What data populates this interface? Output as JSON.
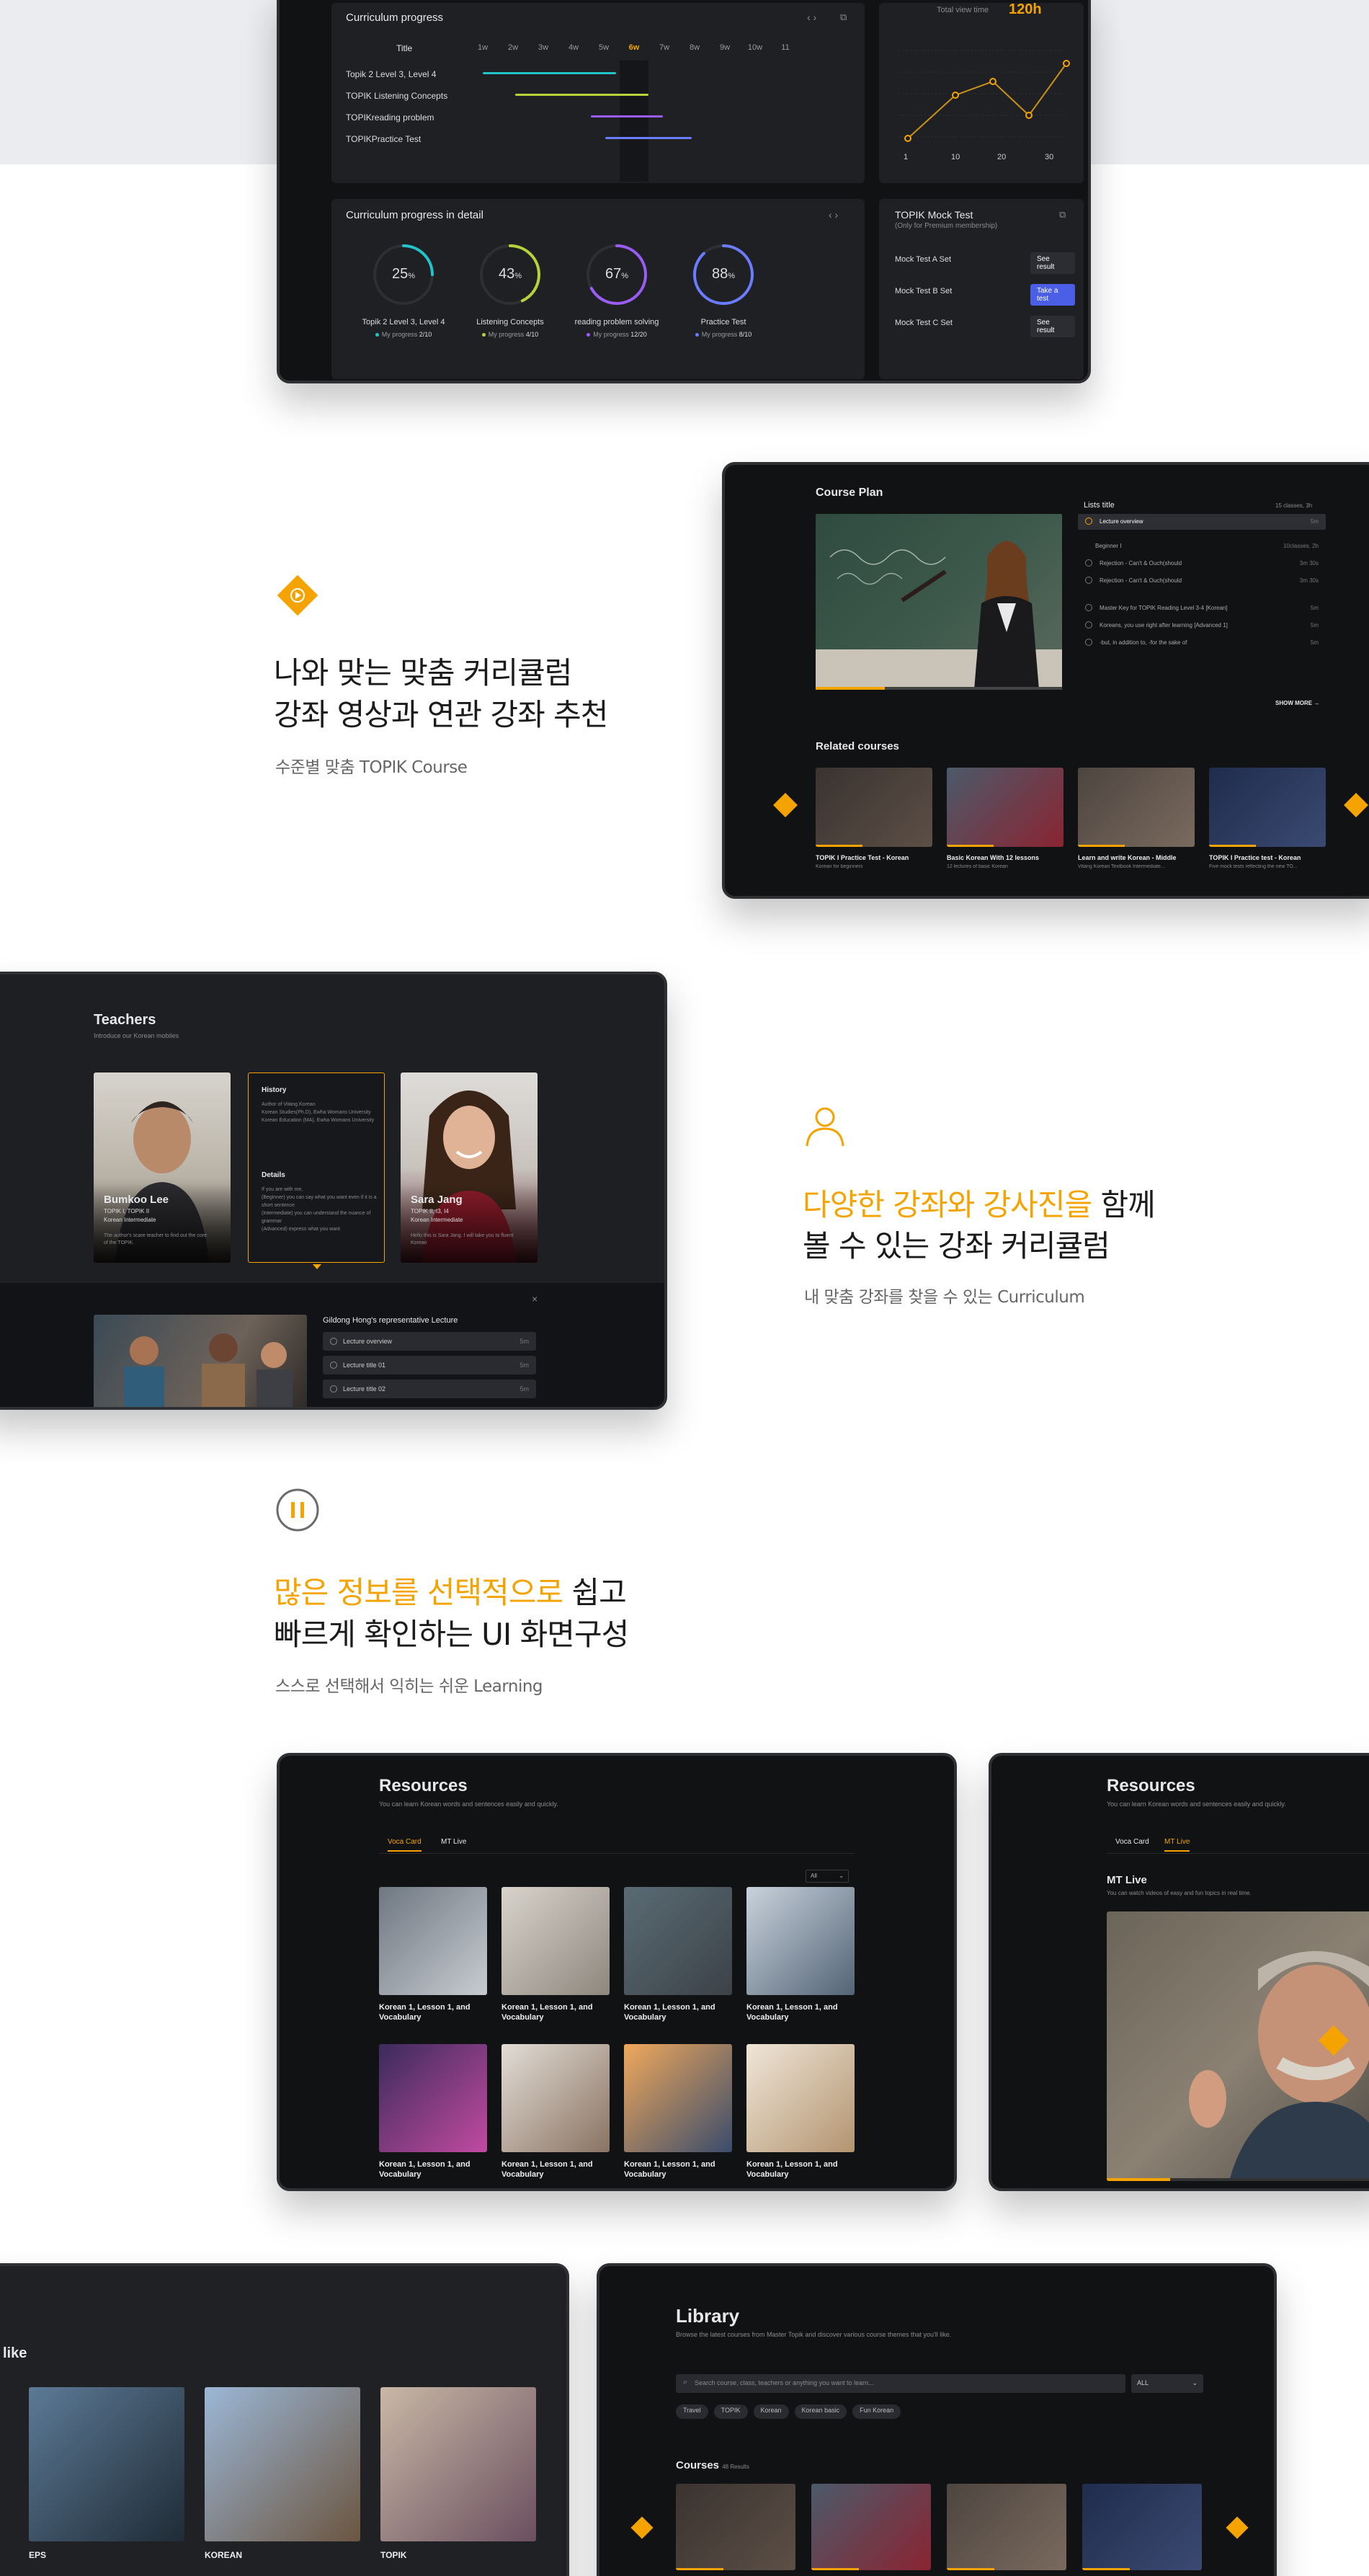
{
  "section1": {
    "curriculum_title": "Curriculum progress",
    "col_title": "Title",
    "weeks": [
      "1w",
      "2w",
      "3w",
      "4w",
      "5w",
      "6w",
      "7w",
      "8w",
      "9w",
      "10w",
      "11"
    ],
    "active_week": "6w",
    "rows": [
      {
        "label": "Topik 2 Level 3, Level 4",
        "color": "#22c3c9"
      },
      {
        "label": "TOPIK Listening Concepts",
        "color": "#b6d43a"
      },
      {
        "label": "TOPIKreading problem",
        "color": "#9b5cf5"
      },
      {
        "label": "TOPIKPractice Test",
        "color": "#6b7cff"
      }
    ],
    "view_time_label": "Total view time",
    "view_time_value": "120h",
    "chart_x": [
      "1",
      "10",
      "20",
      "30"
    ],
    "detail_title": "Curriculum progress in detail",
    "details": [
      {
        "pct": "25",
        "unit": "%",
        "name": "Topik 2 Level 3, Level 4",
        "mine": "My progress",
        "count": "2/10",
        "color": "#22c3c9",
        "value": 25
      },
      {
        "pct": "43",
        "unit": "%",
        "name": "Listening Concepts",
        "mine": "My progress",
        "count": "4/10",
        "color": "#b6d43a",
        "value": 43
      },
      {
        "pct": "67",
        "unit": "%",
        "name": "reading problem solving",
        "mine": "My progress",
        "count": "12/20",
        "color": "#9b5cf5",
        "value": 67
      },
      {
        "pct": "88",
        "unit": "%",
        "name": "Practice Test",
        "mine": "My progress",
        "count": "8/10",
        "color": "#6b7cff",
        "value": 88
      }
    ],
    "mock_title": "TOPIK Mock Test",
    "mock_sub": "(Only for Premium membership)",
    "mocks": [
      {
        "label": "Mock Test A Set",
        "btn": "See result"
      },
      {
        "label": "Mock Test B Set",
        "btn": "Take a test"
      },
      {
        "label": "Mock Test C Set",
        "btn": "See result"
      }
    ]
  },
  "feature1": {
    "line1": "나와 맞는 맞춤 커리큘럼",
    "line2": "강좌 영상과 연관 강좌 추천",
    "sub": "수준별 맞춤 TOPIK Course"
  },
  "course_plan": {
    "title": "Course Plan",
    "list_title": "Lists title",
    "list_meta": "15 classes, 3h",
    "items": [
      {
        "label": "Lecture overview",
        "time": "5m"
      },
      {
        "label": "Beginner I",
        "time": "10classes, 2h"
      },
      {
        "label": "Rejection - Can't & Ouch(should",
        "time": "3m 30s"
      },
      {
        "label": "Rejection - Can't & Ouch(should",
        "time": "3m 30s"
      },
      {
        "label": "Master Key for TOPIK Reading Level 3-4 [Korean]",
        "time": "5m"
      },
      {
        "label": "Koreans, you use right after learning [Advanced 1]",
        "time": "5m"
      },
      {
        "label": "-but, in addition to, -for the sake of",
        "time": "5m"
      }
    ],
    "show_more": "SHOW MORE →",
    "related_title": "Related courses",
    "related": [
      {
        "title": "TOPIK I Practice Test - Korean",
        "sub": "Korean for beginners"
      },
      {
        "title": "Basic Korean With 12 lessons",
        "sub": "12 lectures of basic Korean"
      },
      {
        "title": "Learn and write Korean - Middle",
        "sub": "Vitang Korean Textbook Intermediate..."
      },
      {
        "title": "TOPIK I Practice test - Korean",
        "sub": "Five mock tests reflecting the new TO..."
      }
    ]
  },
  "teachers": {
    "title": "Teachers",
    "sub": "Introduce our Korean mobiles",
    "t1_name": "Bumkoo Lee",
    "t1_role": "TOPIK I, TOPIK II",
    "t1_level": "Korean Intermediate",
    "t1_desc": "The author's scare teacher to find out the core of the TOPIK.",
    "history_title": "History",
    "history_text": "Author of Vitang Korean\nKorean Studies(Ph.D), Ewha Womans University\nKorean Education (MA), Ewha Womans University",
    "details_title": "Details",
    "details_text": "If you are with me,\n(Beginner) you can say what you want even if it is a short sentence\n(Intermediate) you can understand the nuance of grammar\n(Advanced) express what you want",
    "t3_name": "Sara Jang",
    "t3_role": "TOPIK II, I3, I4",
    "t3_level": "Korean Intermediate",
    "t3_desc": "Hello this is Sara Jang. I will take you to fluent Korean",
    "rep_title": "Gildong Hong's representative Lecture",
    "lessons": [
      {
        "label": "Lecture overview",
        "time": "5m"
      },
      {
        "label": "Lecture title 01",
        "time": "5m"
      },
      {
        "label": "Lecture title 02",
        "time": "5m"
      }
    ]
  },
  "feature2": {
    "line1_hl": "다양한 강좌와 강사진을",
    "line1_rest": " 함께",
    "line2": "볼 수 있는 강좌 커리큘럼",
    "sub": "내 맞춤 강좌를 찾을 수 있는 Curriculum"
  },
  "feature3": {
    "line1_hl": "많은 정보를 선택적으로",
    "line1_rest": " 쉽고",
    "line2": "빠르게 확인하는 UI 화면구성",
    "sub": "스스로 선택해서 익히는 쉬운 Learning"
  },
  "resources": {
    "title": "Resources",
    "sub": "You can learn Korean words and sentences easily and quickly.",
    "tab1": "Voca Card",
    "tab2": "MT Live",
    "filter": "All",
    "card_label": "Korean 1, Lesson 1, and Vocabulary",
    "cards": 8
  },
  "resources2": {
    "title": "Resources",
    "sub": "You can learn Korean words and sentences easily and quickly.",
    "tab1": "Voca Card",
    "tab2": "MT Live",
    "live_title": "MT Live",
    "live_sub": "You can watch videos of easy and fun topics in real time."
  },
  "like": {
    "title": "like",
    "items": [
      "EPS",
      "KOREAN",
      "TOPIK"
    ]
  },
  "library": {
    "title": "Library",
    "sub": "Browse the latest courses from Master Topik and discover various course themes that you'll like.",
    "search_placeholder": "Search course, class, teachers or anything you want to learn...",
    "select": "ALL",
    "chips": [
      "Travel",
      "TOPIK",
      "Korean",
      "Korean basic",
      "Fun Korean"
    ],
    "courses_label": "Courses",
    "courses_count": "48 Results"
  },
  "colors": {
    "accent": "#f5a300",
    "device": "#111214",
    "panel": "#1f2024"
  }
}
